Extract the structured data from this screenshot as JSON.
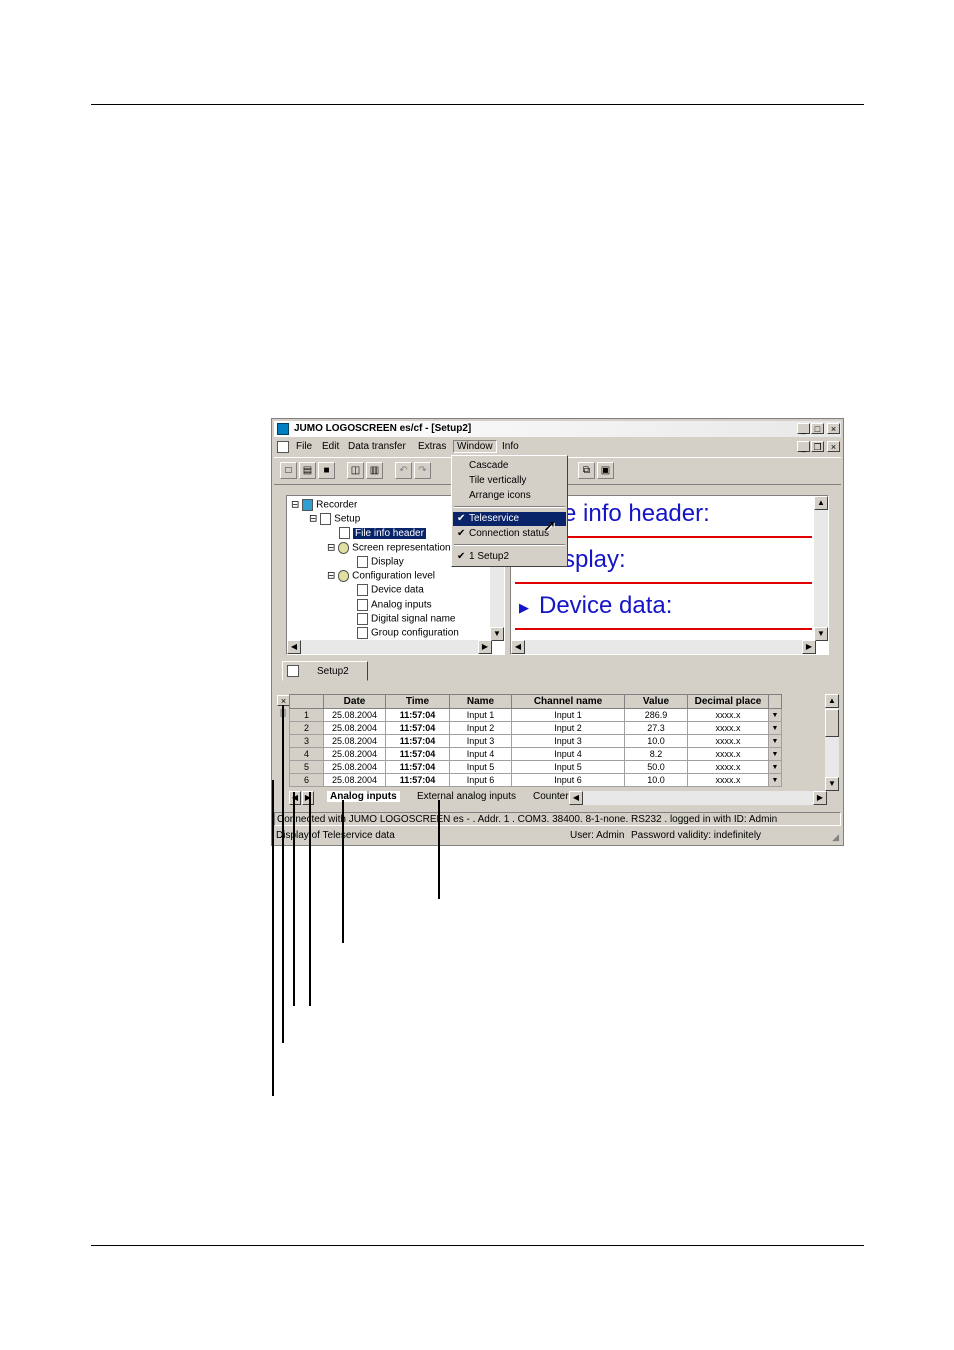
{
  "window": {
    "title": "JUMO LOGOSCREEN es/cf - [Setup2]"
  },
  "menu": [
    "File",
    "Edit",
    "Data transfer",
    "Extras",
    "Window",
    "Info"
  ],
  "window_menu": {
    "items": [
      "Cascade",
      "Tile vertically",
      "Arrange icons"
    ],
    "checked_items": [
      "Teleservice",
      "Connection status"
    ],
    "window_item": "1 Setup2"
  },
  "tree": {
    "items": [
      "Recorder",
      "Setup",
      "File info header",
      "Screen representation",
      "Display",
      "Configuration level",
      "Device data",
      "Analog inputs",
      "Digital signal name",
      "Group configuration"
    ]
  },
  "preview": {
    "headings": [
      "e info header:",
      "splay:",
      "Device data:"
    ]
  },
  "doc_tab": "Setup2",
  "grid": {
    "columns": [
      "Date",
      "Time",
      "Name",
      "Channel name",
      "Value",
      "Decimal place"
    ],
    "rows": [
      {
        "n": "1",
        "date": "25.08.2004",
        "time": "11:57:04",
        "name": "Input 1",
        "channel": "Input 1",
        "value": "286.9",
        "decimal": "xxxx.x"
      },
      {
        "n": "2",
        "date": "25.08.2004",
        "time": "11:57:04",
        "name": "Input 2",
        "channel": "Input 2",
        "value": "27.3",
        "decimal": "xxxx.x"
      },
      {
        "n": "3",
        "date": "25.08.2004",
        "time": "11:57:04",
        "name": "Input 3",
        "channel": "Input 3",
        "value": "10.0",
        "decimal": "xxxx.x"
      },
      {
        "n": "4",
        "date": "25.08.2004",
        "time": "11:57:04",
        "name": "Input 4",
        "channel": "Input 4",
        "value": "8.2",
        "decimal": "xxxx.x"
      },
      {
        "n": "5",
        "date": "25.08.2004",
        "time": "11:57:04",
        "name": "Input 5",
        "channel": "Input 5",
        "value": "50.0",
        "decimal": "xxxx.x"
      },
      {
        "n": "6",
        "date": "25.08.2004",
        "time": "11:57:04",
        "name": "Input 6",
        "channel": "Input 6",
        "value": "10.0",
        "decimal": "xxxx.x"
      }
    ]
  },
  "sheet_tabs": [
    "Analog inputs",
    "External analog inputs",
    "Counter"
  ],
  "status": {
    "connection": "Connected with JUMO LOGOSCREEN es - . Addr. 1 . COM3. 38400. 8-1-none. RS232 . logged in with ID: Admin",
    "left": "Display of Teleservice data",
    "user": "User: Admin",
    "password": "Password validity: indefinitely"
  }
}
